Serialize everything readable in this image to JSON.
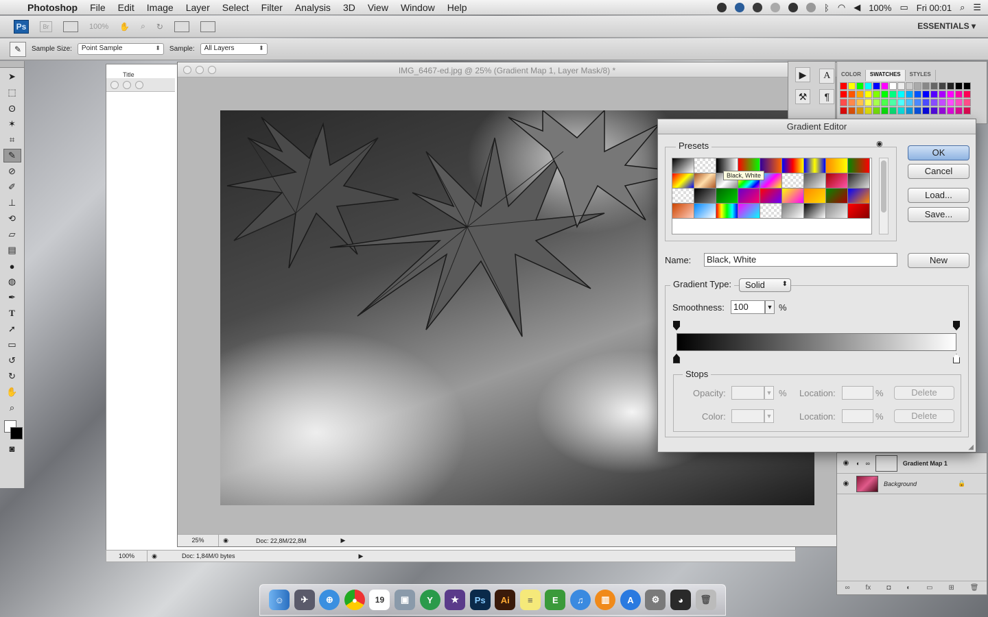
{
  "menubar": {
    "app": "Photoshop",
    "menus": [
      "File",
      "Edit",
      "Image",
      "Layer",
      "Select",
      "Filter",
      "Analysis",
      "3D",
      "View",
      "Window",
      "Help"
    ],
    "battery": "100%",
    "clock": "Fri 00:01"
  },
  "appbar": {
    "ps_logo": "Ps",
    "br_logo": "Br",
    "zoom": "100%",
    "workspace": "ESSENTIALS ▾"
  },
  "options": {
    "sample_size_label": "Sample Size:",
    "sample_size_value": "Point Sample",
    "sample_label": "Sample:",
    "sample_value": "All Layers"
  },
  "back_document": {
    "title": "Title",
    "zoom": "100%",
    "doc_info": "Doc: 1,84M/0 bytes"
  },
  "document": {
    "title": "IMG_6467-ed.jpg @ 25% (Gradient Map 1, Layer Mask/8) *",
    "zoom": "25%",
    "doc_info": "Doc: 22,8M/22,8M"
  },
  "panels": {
    "tabs": [
      "COLOR",
      "SWATCHES",
      "STYLES"
    ],
    "active_tab": "SWATCHES"
  },
  "layers": [
    {
      "name": "Gradient Map 1"
    },
    {
      "name": "Background"
    }
  ],
  "gradient_editor": {
    "title": "Gradient Editor",
    "presets_label": "Presets",
    "tooltip": "Black, White",
    "buttons": {
      "ok": "OK",
      "cancel": "Cancel",
      "load": "Load...",
      "save": "Save...",
      "new": "New"
    },
    "name_label": "Name:",
    "name_value": "Black, White",
    "gradient_type_label": "Gradient Type:",
    "gradient_type_value": "Solid",
    "smoothness_label": "Smoothness:",
    "smoothness_value": "100",
    "percent": "%",
    "stops_label": "Stops",
    "opacity_label": "Opacity:",
    "color_label": "Color:",
    "location_label": "Location:",
    "delete_label": "Delete"
  }
}
